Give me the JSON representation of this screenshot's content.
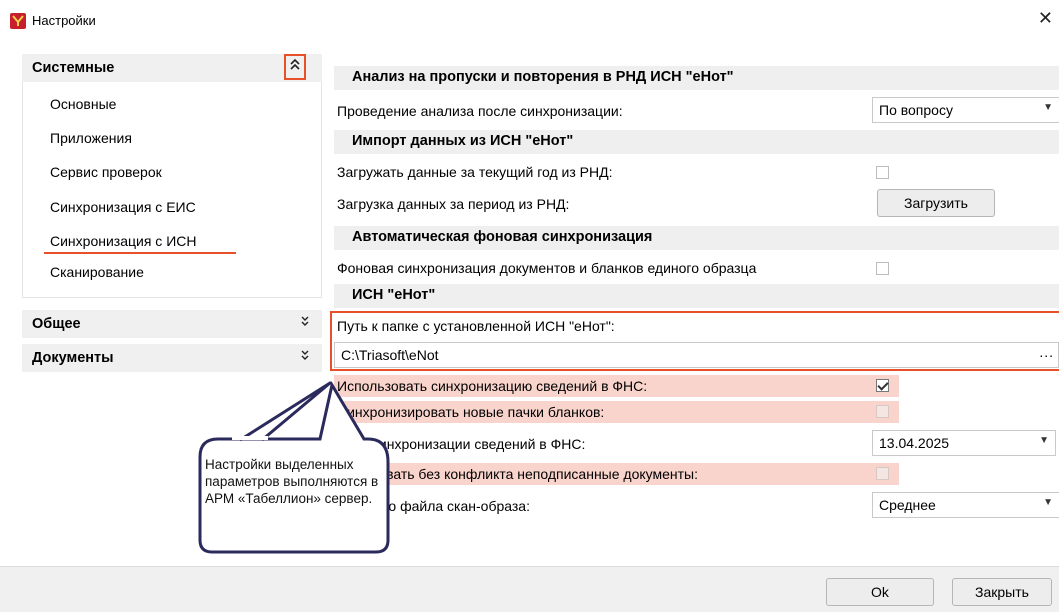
{
  "window": {
    "title": "Настройки",
    "close_glyph": "✕"
  },
  "sidebar": {
    "groups": [
      {
        "title": "Системные",
        "chevron": "⌃⌃",
        "expanded": true
      },
      {
        "title": "Общее",
        "chevron": "⌄⌄",
        "expanded": false
      },
      {
        "title": "Документы",
        "chevron": "⌄⌄",
        "expanded": false
      }
    ],
    "items": [
      {
        "label": "Основные"
      },
      {
        "label": "Приложения"
      },
      {
        "label": "Сервис проверок"
      },
      {
        "label": "Синхронизация с ЕИС"
      },
      {
        "label": "Синхронизация с ИСН",
        "selected": true
      },
      {
        "label": "Сканирование"
      }
    ]
  },
  "sections": {
    "analysis": {
      "title": "Анализ на пропуски и повторения в РНД ИСН \"еНот\"",
      "row_label": "Проведение анализа после синхронизации:",
      "dropdown_value": "По вопросу"
    },
    "import": {
      "title": "Импорт данных из ИСН \"еНот\"",
      "row1_label": "Загружать данные за текущий год из РНД:",
      "row1_checked": false,
      "row2_label": "Загрузка данных за период из РНД:",
      "row2_button": "Загрузить"
    },
    "auto_sync": {
      "title": "Автоматическая фоновая синхронизация",
      "row_label": "Фоновая синхронизация документов и бланков единого образца",
      "row_checked": false
    },
    "isn": {
      "title": "ИСН \"еНот\"",
      "path_label": "Путь к папке с установленной ИСН \"еНот\":",
      "path_value": "C:\\Triasoft\\eNot",
      "path_button": "..."
    }
  },
  "settings": {
    "use_fns_sync": {
      "label": "Использовать синхронизацию сведений в ФНС:",
      "checked": true
    },
    "sync_new_packs": {
      "label": "Синхронизировать новые пачки бланков:",
      "checked": false
    },
    "fns_sync_date": {
      "label": "Дата синхронизации сведений в ФНС:",
      "value": "13.04.2025"
    },
    "send_unsigned": {
      "label": "Передавать без конфликта неподписанные документы:",
      "checked": false
    },
    "scan_quality": {
      "label": "Качество файла скан-образа:",
      "value": "Среднее"
    }
  },
  "footer": {
    "ok_label": "Ok",
    "close_label": "Закрыть"
  },
  "callout": {
    "text": "Настройки выделенных параметров выполняются в АРМ «Табеллион» сервер."
  },
  "colors": {
    "accent": "#e8502a",
    "highlight": "#f9d4cc",
    "callout_border": "#2b2a5c",
    "app_icon": "#c8202b"
  }
}
